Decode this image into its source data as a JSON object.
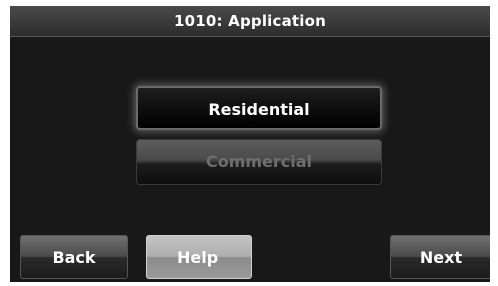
{
  "header": {
    "title": "1010: Application"
  },
  "options": [
    {
      "label": "Residential",
      "selected": true
    },
    {
      "label": "Commercial",
      "selected": false
    }
  ],
  "footer": {
    "back_label": "Back",
    "help_label": "Help",
    "next_label": "Next"
  },
  "colors": {
    "screen_background": "#181818",
    "title_text": "#ffffff",
    "selected_text": "#ffffff",
    "unselected_text": "#6e6e6e",
    "help_button": "#aeaeae"
  }
}
